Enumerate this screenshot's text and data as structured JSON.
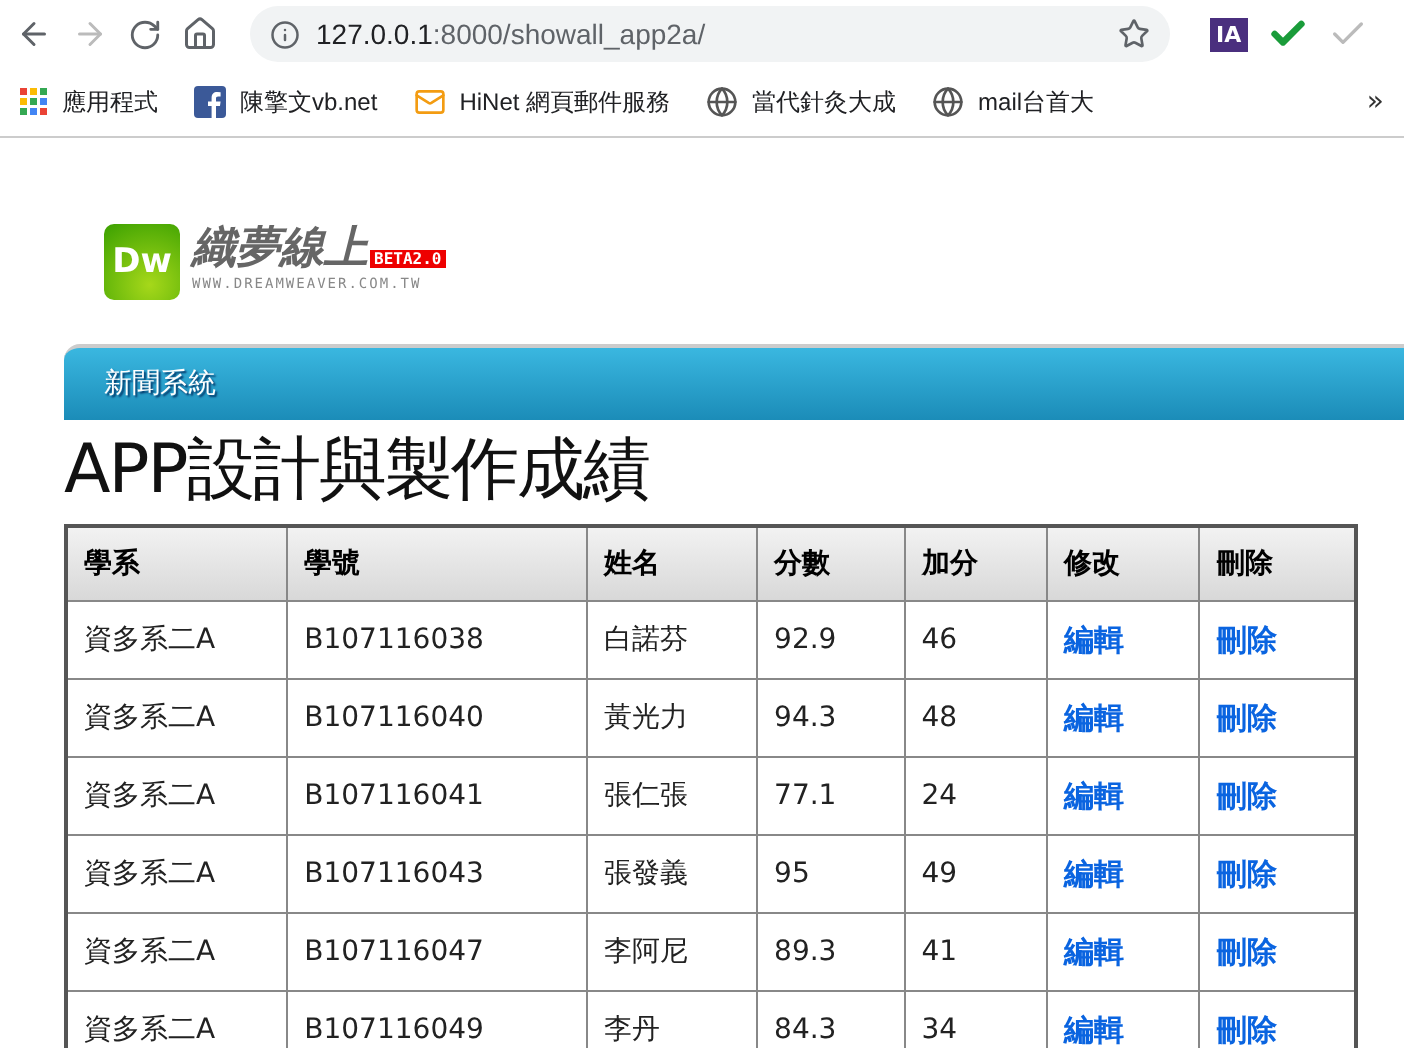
{
  "browser": {
    "url_host": "127.0.0.1",
    "url_path": ":8000/showall_app2a/",
    "extensions": [
      "IA"
    ]
  },
  "bookmarks": [
    {
      "label": "應用程式",
      "kind": "apps"
    },
    {
      "label": "陳擎文vb.net",
      "kind": "facebook"
    },
    {
      "label": "HiNet 網頁郵件服務",
      "kind": "mail"
    },
    {
      "label": "當代針灸大成",
      "kind": "globe"
    },
    {
      "label": "mail台首大",
      "kind": "globe"
    }
  ],
  "more": "»",
  "logo": {
    "mark": "Dw",
    "title": "織夢線上",
    "badge": "BETA2.0",
    "site": "WWW.DREAMWEAVER.COM.TW"
  },
  "nav": {
    "title": "新聞系統"
  },
  "heading": "APP設計與製作成績",
  "table": {
    "columns": [
      "學系",
      "學號",
      "姓名",
      "分數",
      "加分",
      "修改",
      "刪除"
    ],
    "rows": [
      [
        "資多系二A",
        "B107116038",
        "白諾芬",
        "92.9",
        "46",
        "編輯",
        "刪除"
      ],
      [
        "資多系二A",
        "B107116040",
        "黃光力",
        "94.3",
        "48",
        "編輯",
        "刪除"
      ],
      [
        "資多系二A",
        "B107116041",
        "張仁張",
        "77.1",
        "24",
        "編輯",
        "刪除"
      ],
      [
        "資多系二A",
        "B107116043",
        "張發義",
        "95",
        "49",
        "編輯",
        "刪除"
      ],
      [
        "資多系二A",
        "B107116047",
        "李阿尼",
        "89.3",
        "41",
        "編輯",
        "刪除"
      ],
      [
        "資多系二A",
        "B107116049",
        "李丹",
        "84.3",
        "34",
        "編輯",
        "刪除"
      ]
    ]
  }
}
